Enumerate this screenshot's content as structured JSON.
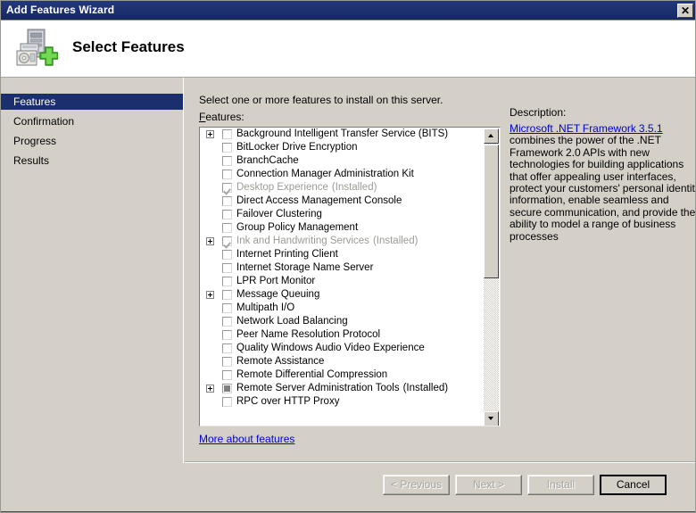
{
  "window": {
    "title": "Add Features Wizard",
    "close_label": "✕"
  },
  "header": {
    "title": "Select Features",
    "icon": "server-add-icon"
  },
  "sidebar": {
    "items": [
      {
        "label": "Features",
        "selected": true
      },
      {
        "label": "Confirmation",
        "selected": false
      },
      {
        "label": "Progress",
        "selected": false
      },
      {
        "label": "Results",
        "selected": false
      }
    ]
  },
  "main": {
    "instruction": "Select one or more features to install on this server.",
    "features_label_prefix": "F",
    "features_label_rest": "eatures:",
    "more_link": "More about features",
    "features": [
      {
        "label": "Background Intelligent Transfer Service (BITS)",
        "expandable": true,
        "state": "unchecked",
        "installed": ""
      },
      {
        "label": "BitLocker Drive Encryption",
        "expandable": false,
        "state": "unchecked",
        "installed": ""
      },
      {
        "label": "BranchCache",
        "expandable": false,
        "state": "unchecked",
        "installed": ""
      },
      {
        "label": "Connection Manager Administration Kit",
        "expandable": false,
        "state": "unchecked",
        "installed": ""
      },
      {
        "label": "Desktop Experience",
        "expandable": false,
        "state": "checked-gray",
        "installed": "(Installed)"
      },
      {
        "label": "Direct Access Management Console",
        "expandable": false,
        "state": "unchecked",
        "installed": ""
      },
      {
        "label": "Failover Clustering",
        "expandable": false,
        "state": "unchecked",
        "installed": ""
      },
      {
        "label": "Group Policy Management",
        "expandable": false,
        "state": "unchecked",
        "installed": ""
      },
      {
        "label": "Ink and Handwriting Services",
        "expandable": true,
        "state": "checked-gray",
        "installed": "(Installed)"
      },
      {
        "label": "Internet Printing Client",
        "expandable": false,
        "state": "unchecked",
        "installed": ""
      },
      {
        "label": "Internet Storage Name Server",
        "expandable": false,
        "state": "unchecked",
        "installed": ""
      },
      {
        "label": "LPR Port Monitor",
        "expandable": false,
        "state": "unchecked",
        "installed": ""
      },
      {
        "label": "Message Queuing",
        "expandable": true,
        "state": "unchecked",
        "installed": ""
      },
      {
        "label": "Multipath I/O",
        "expandable": false,
        "state": "unchecked",
        "installed": ""
      },
      {
        "label": "Network Load Balancing",
        "expandable": false,
        "state": "unchecked",
        "installed": ""
      },
      {
        "label": "Peer Name Resolution Protocol",
        "expandable": false,
        "state": "unchecked",
        "installed": ""
      },
      {
        "label": "Quality Windows Audio Video Experience",
        "expandable": false,
        "state": "unchecked",
        "installed": ""
      },
      {
        "label": "Remote Assistance",
        "expandable": false,
        "state": "unchecked",
        "installed": ""
      },
      {
        "label": "Remote Differential Compression",
        "expandable": false,
        "state": "unchecked",
        "installed": ""
      },
      {
        "label": "Remote Server Administration Tools",
        "expandable": true,
        "state": "partial",
        "installed": "(Installed)"
      },
      {
        "label": "RPC over HTTP Proxy",
        "expandable": false,
        "state": "unchecked",
        "installed": ""
      }
    ]
  },
  "description": {
    "title": "Description:",
    "link_text": "Microsoft .NET Framework 3.5.1",
    "body_text": " combines the power of the .NET Framework 2.0 APIs with new technologies for building applications that offer appealing user interfaces, protect your customers' personal identity information, enable seamless and secure communication, and provide the ability to model a range of business processes"
  },
  "footer": {
    "buttons": [
      {
        "label": "< Previous",
        "disabled": true,
        "default": false
      },
      {
        "label": "Next >",
        "disabled": true,
        "default": false
      },
      {
        "label": "Install",
        "disabled": true,
        "default": false
      },
      {
        "label": "Cancel",
        "disabled": false,
        "default": true
      }
    ]
  },
  "colors": {
    "titlebar": "#1b2f6e",
    "dialog_face": "#d4d0c8",
    "link": "#0000d8",
    "selected_nav": "#1b2f6e",
    "disabled_text": "#a6a6a0"
  }
}
